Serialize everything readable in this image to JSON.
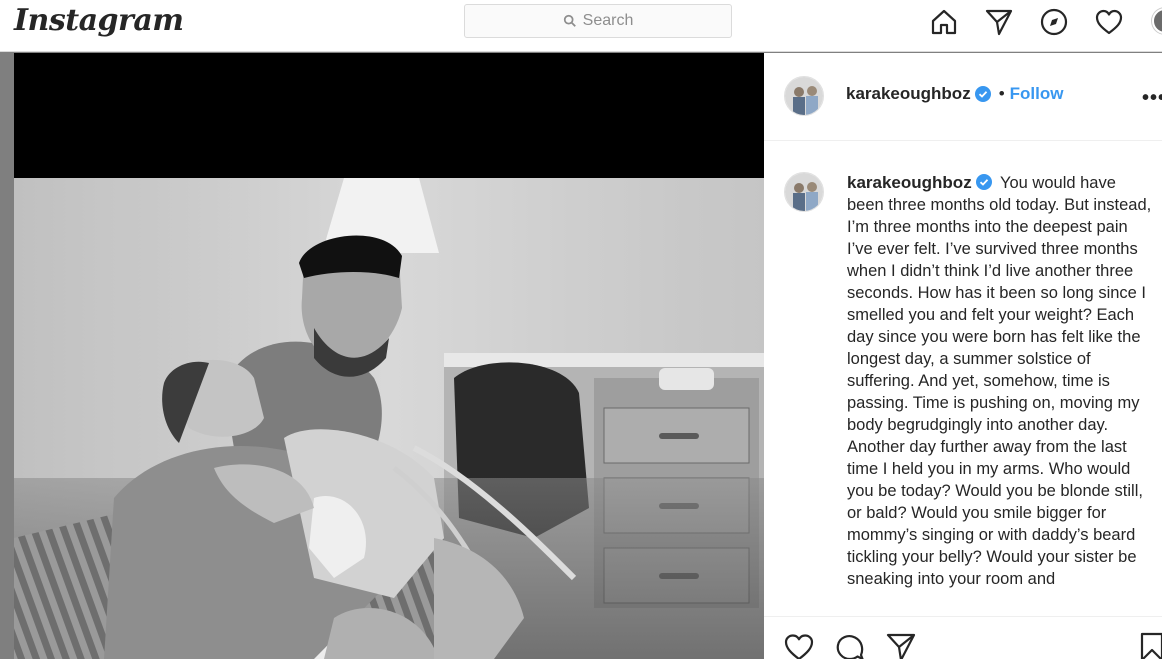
{
  "header": {
    "logo": "Instagram",
    "search_placeholder": "Search",
    "icons": [
      "home-icon",
      "direct-icon",
      "explore-icon",
      "activity-heart-icon",
      "profile-avatar"
    ]
  },
  "post": {
    "author": "karakeoughboz",
    "verified": true,
    "separator": "•",
    "follow_label": "Follow",
    "more_label": "•••",
    "caption": "You would have been three months old today. But instead, I’m three months into the deepest pain I’ve ever felt. I’ve survived three months when I didn’t think I’d live another three seconds. How has it been so long since I smelled you and felt your weight? Each day since you were born has felt like the longest day, a summer solstice of suffering. And yet, somehow, time is passing. Time is pushing on, moving my body begrudgingly into another day. Another day further away from the last time I held you in my arms. Who would you be today? Would you be blonde still, or bald? Would you smile bigger for mommy’s singing or with daddy’s beard tickling your belly? Would your sister be sneaking into your room and",
    "action_icons": [
      "like-icon",
      "comment-icon",
      "share-icon",
      "save-icon"
    ]
  },
  "colors": {
    "accent": "#3897f0",
    "text": "#262626",
    "muted": "#8e8e8e",
    "overlay": "#808080"
  }
}
